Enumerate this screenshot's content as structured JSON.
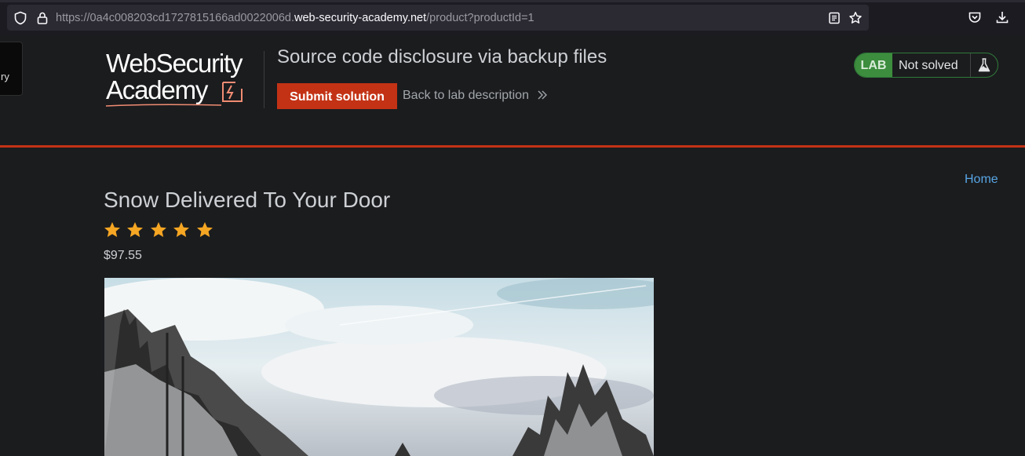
{
  "browser": {
    "url_prefix": "https://0a4c008203cd1727815166ad0022006d.",
    "url_host": "web-security-academy.net",
    "url_path": "/product?productId=1",
    "icons": [
      "shield-icon",
      "lock-icon",
      "reader-view-icon",
      "bookmark-star-icon",
      "pocket-icon",
      "download-icon"
    ]
  },
  "side_tab": {
    "label": "ry"
  },
  "header": {
    "logo_line1": "WebSecurity",
    "logo_line2": "Academy",
    "lab_title": "Source code disclosure via backup files",
    "submit_label": "Submit solution",
    "back_label": "Back to lab description",
    "status_badge": "LAB",
    "status_text": "Not solved",
    "accent_color": "#c33215",
    "status_color": "#3c8d3d"
  },
  "nav": {
    "home_label": "Home"
  },
  "product": {
    "title": "Snow Delivered To Your Door",
    "rating": 5,
    "rating_max": 5,
    "price": "$97.55",
    "star_color": "#f5a623"
  }
}
